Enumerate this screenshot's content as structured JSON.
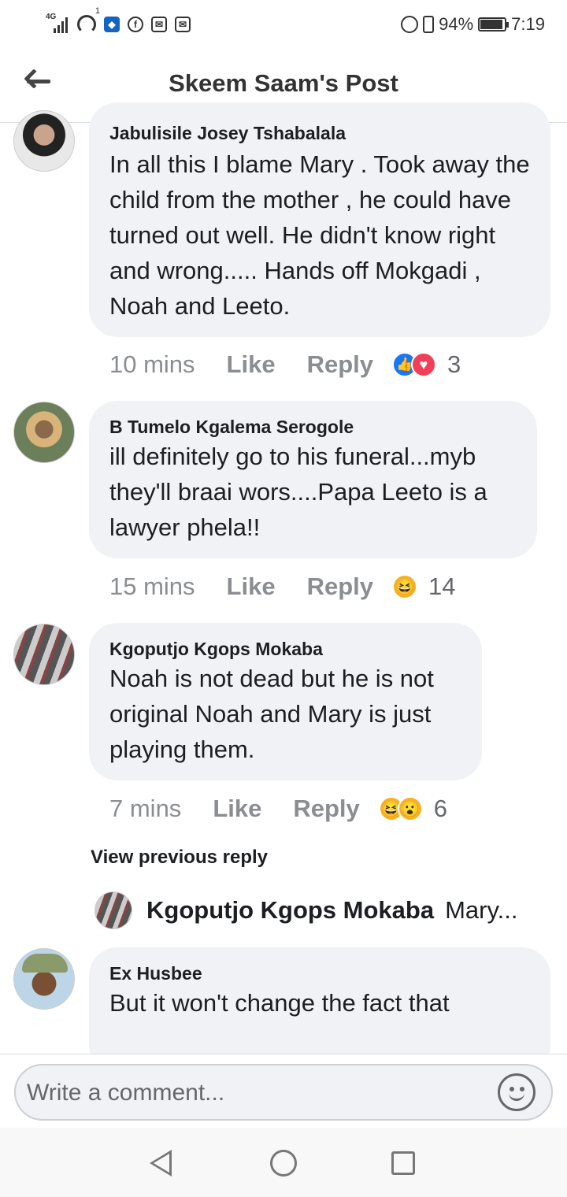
{
  "status_bar": {
    "network": "4G",
    "wifi_badge": "1",
    "battery": "94%",
    "battery_level": 0.94,
    "time": "7:19",
    "icons": [
      "signal-icon",
      "wifi-icon",
      "shield-app-icon",
      "facebook-icon",
      "mail-icon",
      "mail-icon",
      "alarm-icon",
      "vibrate-icon",
      "battery-icon"
    ]
  },
  "header": {
    "title": "Skeem Saam's Post",
    "back_icon": "arrow-left-icon"
  },
  "comments": [
    {
      "name": "Jabulisile Josey Tshabalala",
      "text": "In all this I blame Mary . Took away the child from the mother , he could have turned out well. He didn't know right and wrong..... Hands off Mokgadi , Noah and  Leeto.",
      "time": "10 mins",
      "like": "Like",
      "reply": "Reply",
      "reactions": [
        "like",
        "love"
      ],
      "count": "3"
    },
    {
      "name": "B Tumelo Kgalema Serogole",
      "text": "ill definitely go to his funeral...myb they'll braai wors....Papa Leeto is a lawyer phela!!",
      "time": "15 mins",
      "like": "Like",
      "reply": "Reply",
      "reactions": [
        "haha"
      ],
      "count": "14"
    },
    {
      "name": "Kgoputjo Kgops Mokaba",
      "text": "Noah is not dead but he is not original Noah and Mary is just playing them.",
      "time": "7 mins",
      "like": "Like",
      "reply": "Reply",
      "reactions": [
        "haha",
        "wow"
      ],
      "count": "6"
    },
    {
      "name": "Ex Husbee",
      "text": "But it won't change the fact that"
    }
  ],
  "view_previous": "View previous reply",
  "reply_preview": {
    "name": "Kgoputjo Kgops Mokaba",
    "text": "Mary..."
  },
  "composer": {
    "placeholder": "Write a comment...",
    "emoji_icon": "smiley-icon"
  },
  "nav": {
    "icons": [
      "back-triangle-icon",
      "home-circle-icon",
      "recents-square-icon"
    ]
  }
}
